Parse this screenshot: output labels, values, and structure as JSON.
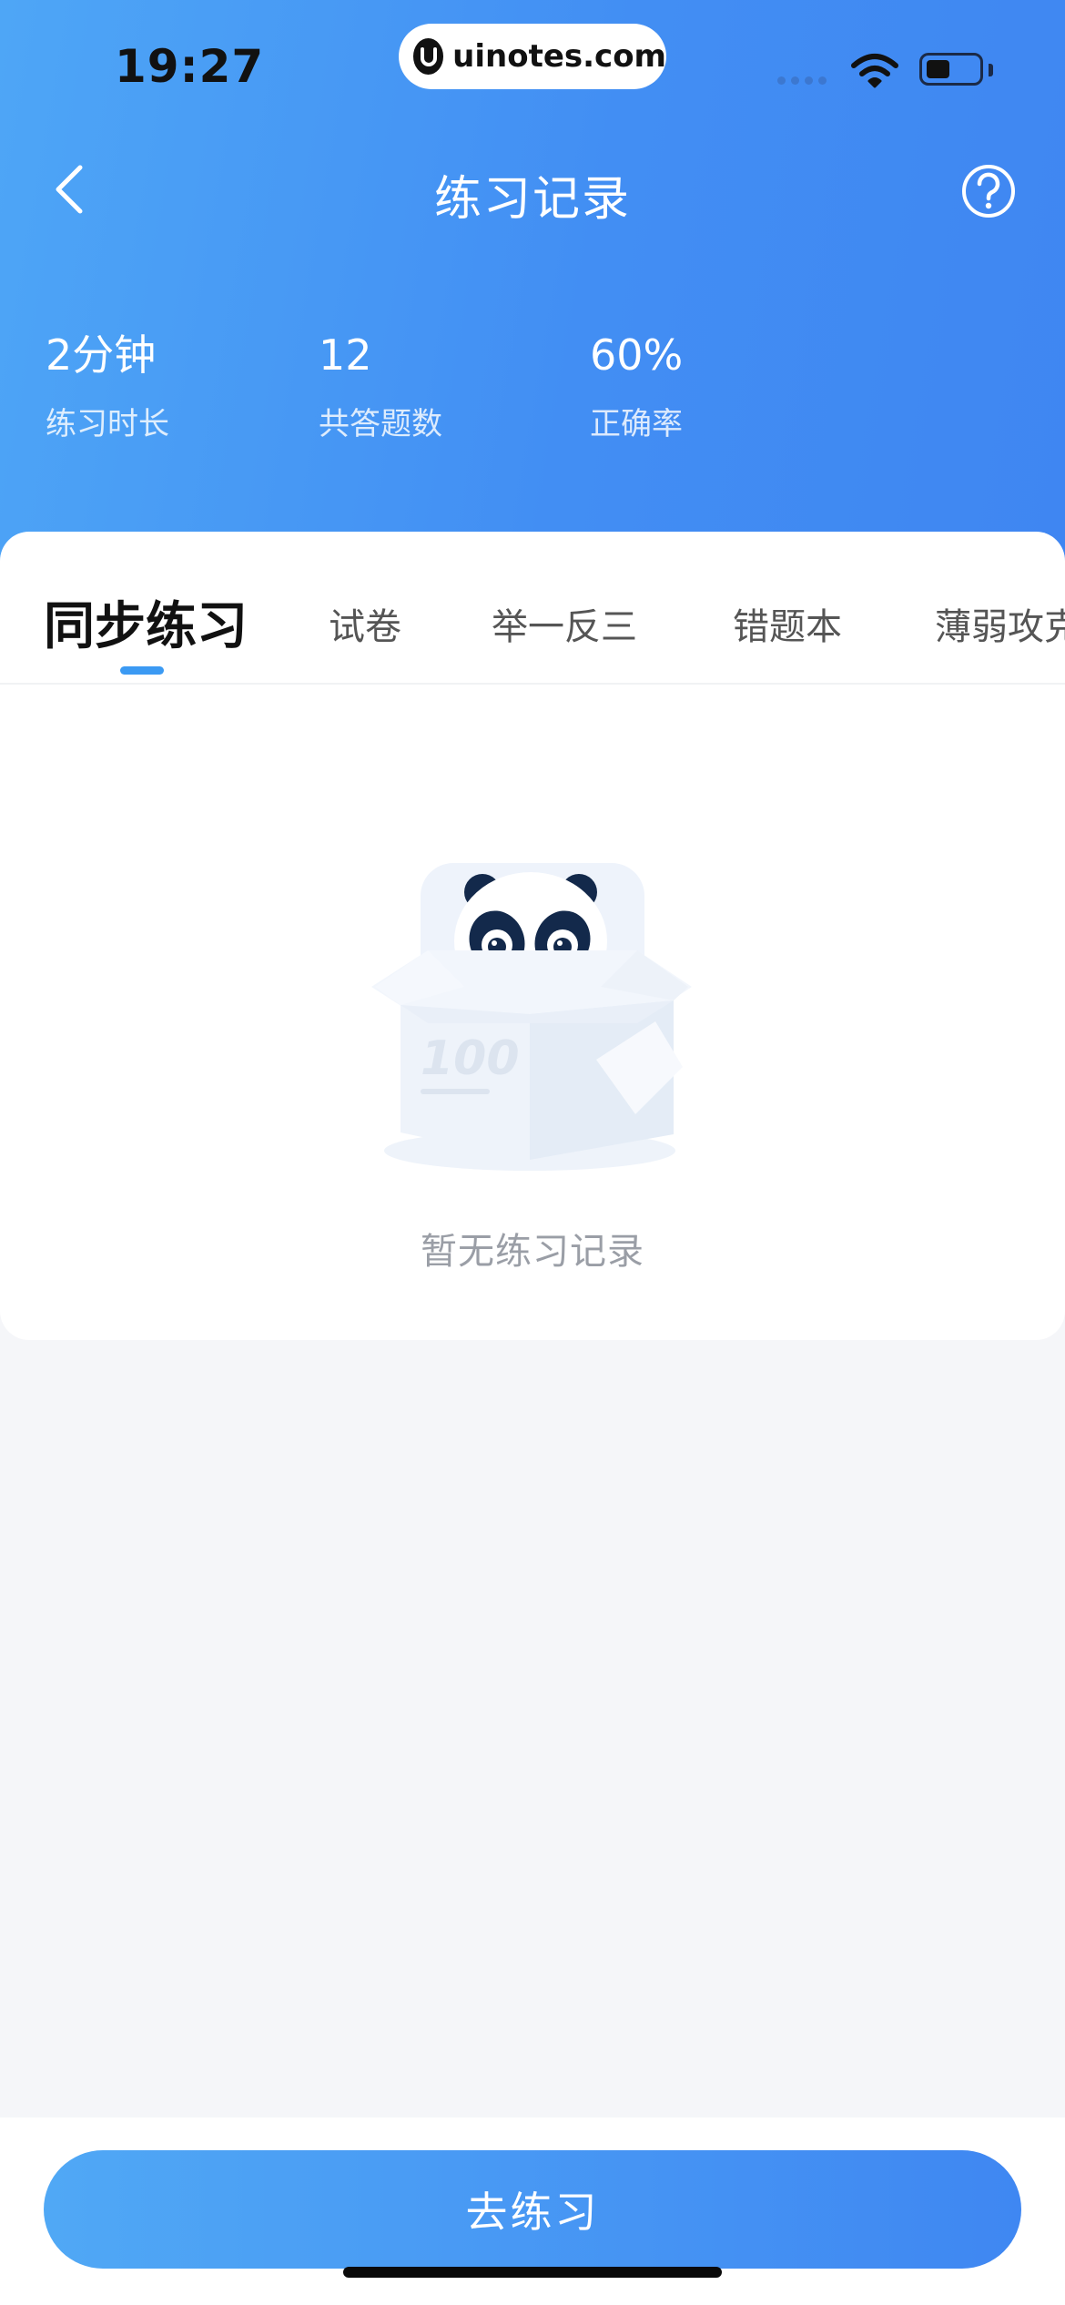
{
  "status_bar": {
    "time": "19:27",
    "watermark": "uinotes.com"
  },
  "header": {
    "title": "练习记录",
    "back_icon": "chevron-left-icon",
    "help_icon": "question-circle-icon"
  },
  "stats": [
    {
      "value": "2分钟",
      "label": "练习时长"
    },
    {
      "value": "12",
      "label": "共答题数"
    },
    {
      "value": "60%",
      "label": "正确率"
    }
  ],
  "tabs": [
    {
      "label": "同步练习",
      "active": true
    },
    {
      "label": "试卷"
    },
    {
      "label": "举一反三"
    },
    {
      "label": "错题本"
    },
    {
      "label": "薄弱攻克"
    }
  ],
  "empty_state": {
    "message": "暂无练习记录",
    "box_mark": "100"
  },
  "cta": {
    "label": "去练习"
  },
  "colors": {
    "accent": "#3f8cf3",
    "header_gradient_start": "#4ea6f6",
    "header_gradient_end": "#3f86f2"
  }
}
